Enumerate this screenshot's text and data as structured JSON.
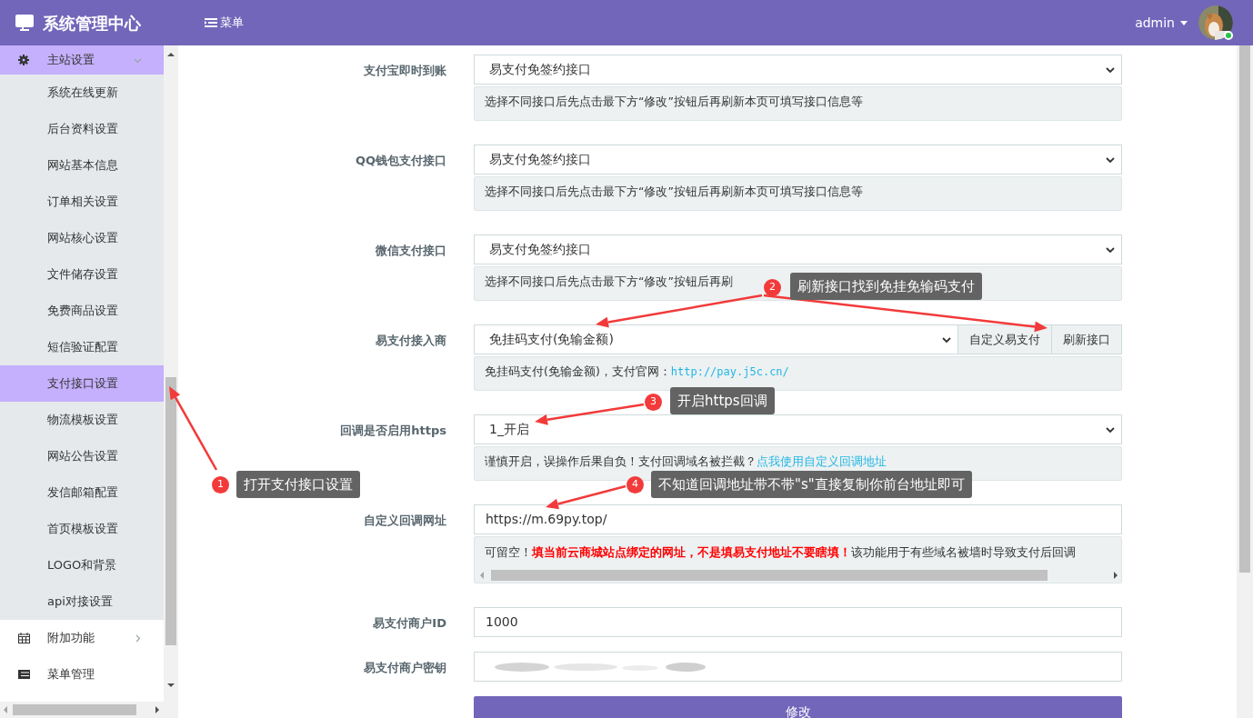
{
  "header": {
    "title": "系统管理中心",
    "menu_label": "菜单",
    "user": "admin",
    "online": true
  },
  "sidebar": {
    "items": [
      {
        "label": "主站设置",
        "expanded": true,
        "selected": true,
        "children": [
          {
            "label": "系统在线更新",
            "selected": false
          },
          {
            "label": "后台资料设置",
            "selected": false
          },
          {
            "label": "网站基本信息",
            "selected": false
          },
          {
            "label": "订单相关设置",
            "selected": false
          },
          {
            "label": "网站核心设置",
            "selected": false
          },
          {
            "label": "文件储存设置",
            "selected": false
          },
          {
            "label": "免费商品设置",
            "selected": false
          },
          {
            "label": "短信验证配置",
            "selected": false
          },
          {
            "label": "支付接口设置",
            "selected": true
          },
          {
            "label": "物流模板设置",
            "selected": false
          },
          {
            "label": "网站公告设置",
            "selected": false
          },
          {
            "label": "发信邮箱配置",
            "selected": false
          },
          {
            "label": "首页模板设置",
            "selected": false
          },
          {
            "label": "LOGO和背景",
            "selected": false
          },
          {
            "label": "api对接设置",
            "selected": false
          }
        ]
      },
      {
        "label": "附加功能",
        "expanded": false,
        "selected": false
      },
      {
        "label": "菜单管理",
        "selected": false
      }
    ]
  },
  "form": {
    "rows": [
      {
        "label": "支付宝即时到账",
        "kind": "select",
        "value": "易支付免签约接口",
        "help": [
          {
            "kind": "plain",
            "text": "选择不同接口后先点击最下方“修改”按钮后再刷新本页可填写接口信息等"
          }
        ]
      },
      {
        "label": "QQ钱包支付接口",
        "kind": "select",
        "value": "易支付免签约接口",
        "help": [
          {
            "kind": "plain",
            "text": "选择不同接口后先点击最下方“修改”按钮后再刷新本页可填写接口信息等"
          }
        ]
      },
      {
        "label": "微信支付接口",
        "kind": "select",
        "value": "易支付免签约接口",
        "help": [
          {
            "kind": "plain",
            "text": "选择不同接口后先点击最下方“修改”按钮后再刷"
          }
        ]
      },
      {
        "label": "易支付接入商",
        "kind": "select",
        "value": "免挂码支付(免输金额)",
        "buttons": [
          "自定义易支付",
          "刷新接口"
        ],
        "help": [
          {
            "kind": "plain",
            "text": "免挂码支付(免输金额)，支付官网："
          },
          {
            "kind": "url",
            "text": "http://pay.j5c.cn/"
          }
        ]
      },
      {
        "label": "回调是否启用https",
        "kind": "select",
        "value": "1_开启",
        "help": [
          {
            "kind": "plain",
            "text": "谨慎开启，误操作后果自负！支付回调域名被拦截？"
          },
          {
            "kind": "link",
            "text": "点我使用自定义回调地址"
          }
        ]
      },
      {
        "label": "自定义回调网址",
        "kind": "input",
        "value": "https://m.69py.top/",
        "scroll_help": true,
        "help": [
          {
            "kind": "plain",
            "text": "可留空！"
          },
          {
            "kind": "warning",
            "text": "填当前云商城站点绑定的网址，不是填易支付地址不要瞎填！"
          },
          {
            "kind": "plain",
            "text": "该功能用于有些域名被墙时导致支付后回调"
          }
        ]
      },
      {
        "label": "易支付商户ID",
        "kind": "input",
        "value": "1000"
      },
      {
        "label": "易支付商户密钥",
        "kind": "redacted"
      }
    ],
    "submit": "修改"
  },
  "annotations": [
    {
      "number": "2",
      "text": "刷新接口找到免挂免输码支付"
    },
    {
      "number": "3",
      "text": "开启https回调"
    },
    {
      "number": "1",
      "text": "打开支付接口设置"
    },
    {
      "number": "4",
      "text": "不知道回调地址带不带\"s\"直接复制你前台地址即可"
    }
  ]
}
